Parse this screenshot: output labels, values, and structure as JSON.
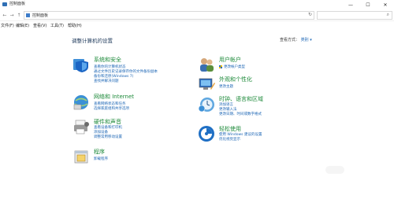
{
  "window": {
    "title": "控制面板",
    "controls": [
      "—",
      "☐",
      "✕"
    ]
  },
  "nav": {
    "back": "←",
    "forward": "→",
    "up": "↑"
  },
  "address": {
    "path": "控制面板",
    "refresh": "↻"
  },
  "search": {
    "placeholder": ""
  },
  "menu": [
    "文件(F)",
    "编辑(E)",
    "查看(V)",
    "工具(T)",
    "帮助(H)"
  ],
  "heading": "调整计算机的设置",
  "view_by": {
    "label": "查看方式：",
    "value": "类别 ▾"
  },
  "categories": [
    {
      "title": "系统和安全",
      "icon": "shield-icon",
      "links": [
        "查看你的计算机状态",
        "通过文件历史记录保存你的文件备份副本",
        "备份和还原(Windows 7)",
        "查找并解决问题"
      ]
    },
    {
      "title": "网络和 Internet",
      "icon": "network-icon",
      "links": [
        "查看网络状态和任务",
        "选择家庭组和共享选项"
      ]
    },
    {
      "title": "硬件和声音",
      "icon": "printer-icon",
      "links": [
        "查看设备和打印机",
        "添加设备",
        "调整常用移动设置"
      ]
    },
    {
      "title": "程序",
      "icon": "programs-icon",
      "links": [
        "卸载程序"
      ]
    },
    {
      "title": "用户帐户",
      "icon": "users-icon",
      "links": [
        "更改帐户类型"
      ]
    },
    {
      "title": "外观和个性化",
      "icon": "appearance-icon",
      "links": [
        "更改主题"
      ]
    },
    {
      "title": "时钟、语言和区域",
      "icon": "clock-icon",
      "links": [
        "添加语言",
        "更改输入法",
        "更改日期、时间或数字格式"
      ]
    },
    {
      "title": "轻松使用",
      "icon": "ease-of-access-icon",
      "links": [
        "使用 Windows 建议的设置",
        "优化视觉显示"
      ]
    }
  ]
}
